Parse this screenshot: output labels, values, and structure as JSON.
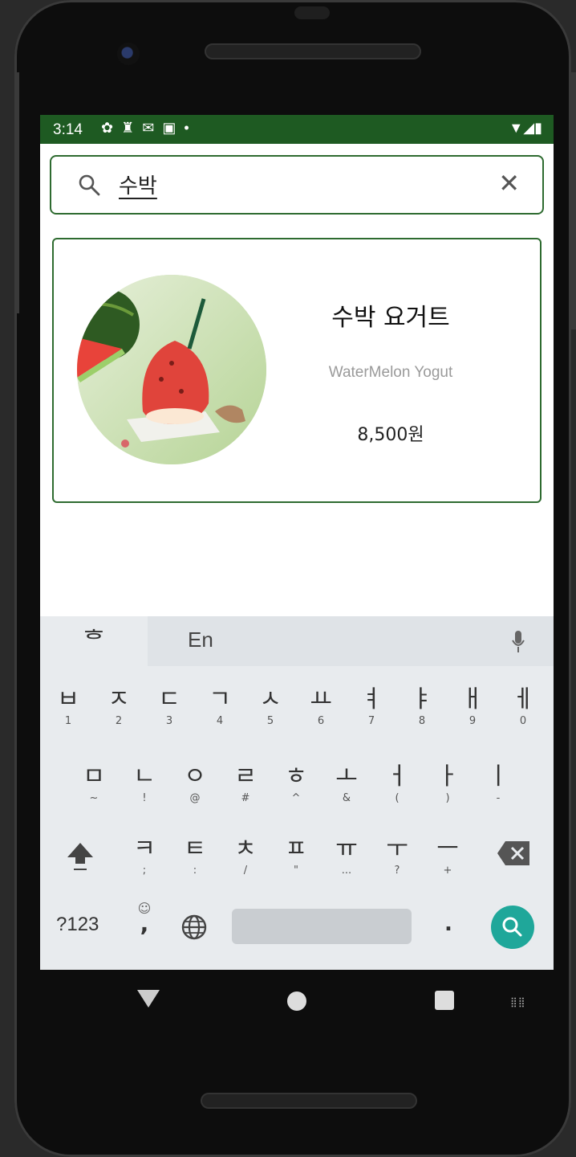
{
  "status_bar": {
    "time": "3:14",
    "left_icons": [
      "settings-icon",
      "cake-icon",
      "gmail-icon",
      "a-box-icon",
      "dot-icon"
    ],
    "right_icons": [
      "wifi-icon",
      "signal-icon",
      "battery-icon"
    ]
  },
  "search": {
    "query": "수박",
    "clear_icon": "close-icon"
  },
  "results": [
    {
      "name_ko": "수박 요거트",
      "name_en": "WaterMelon Yogut",
      "price": "8,500원"
    }
  ],
  "keyboard": {
    "lang_hangul": "ᄒ",
    "lang_en": "En",
    "row1": [
      {
        "k": "ㅂ",
        "s": "1"
      },
      {
        "k": "ㅈ",
        "s": "2"
      },
      {
        "k": "ㄷ",
        "s": "3"
      },
      {
        "k": "ㄱ",
        "s": "4"
      },
      {
        "k": "ㅅ",
        "s": "5"
      },
      {
        "k": "ㅛ",
        "s": "6"
      },
      {
        "k": "ㅕ",
        "s": "7"
      },
      {
        "k": "ㅑ",
        "s": "8"
      },
      {
        "k": "ㅐ",
        "s": "9"
      },
      {
        "k": "ㅔ",
        "s": "0"
      }
    ],
    "row2": [
      {
        "k": "ㅁ",
        "s": "~"
      },
      {
        "k": "ㄴ",
        "s": "!"
      },
      {
        "k": "ㅇ",
        "s": "@"
      },
      {
        "k": "ㄹ",
        "s": "#"
      },
      {
        "k": "ㅎ",
        "s": "^"
      },
      {
        "k": "ㅗ",
        "s": "&"
      },
      {
        "k": "ㅓ",
        "s": "("
      },
      {
        "k": "ㅏ",
        "s": ")"
      },
      {
        "k": "ㅣ",
        "s": "-"
      }
    ],
    "row3": [
      {
        "k": "ㅋ",
        "s": ";"
      },
      {
        "k": "ㅌ",
        "s": ":"
      },
      {
        "k": "ㅊ",
        "s": "/"
      },
      {
        "k": "ㅍ",
        "s": "\""
      },
      {
        "k": "ㅠ",
        "s": "..."
      },
      {
        "k": "ㅜ",
        "s": "?"
      },
      {
        "k": "ㅡ",
        "s": "+"
      }
    ],
    "symbols_label": "?123",
    "comma_label": ",",
    "period_label": "."
  }
}
